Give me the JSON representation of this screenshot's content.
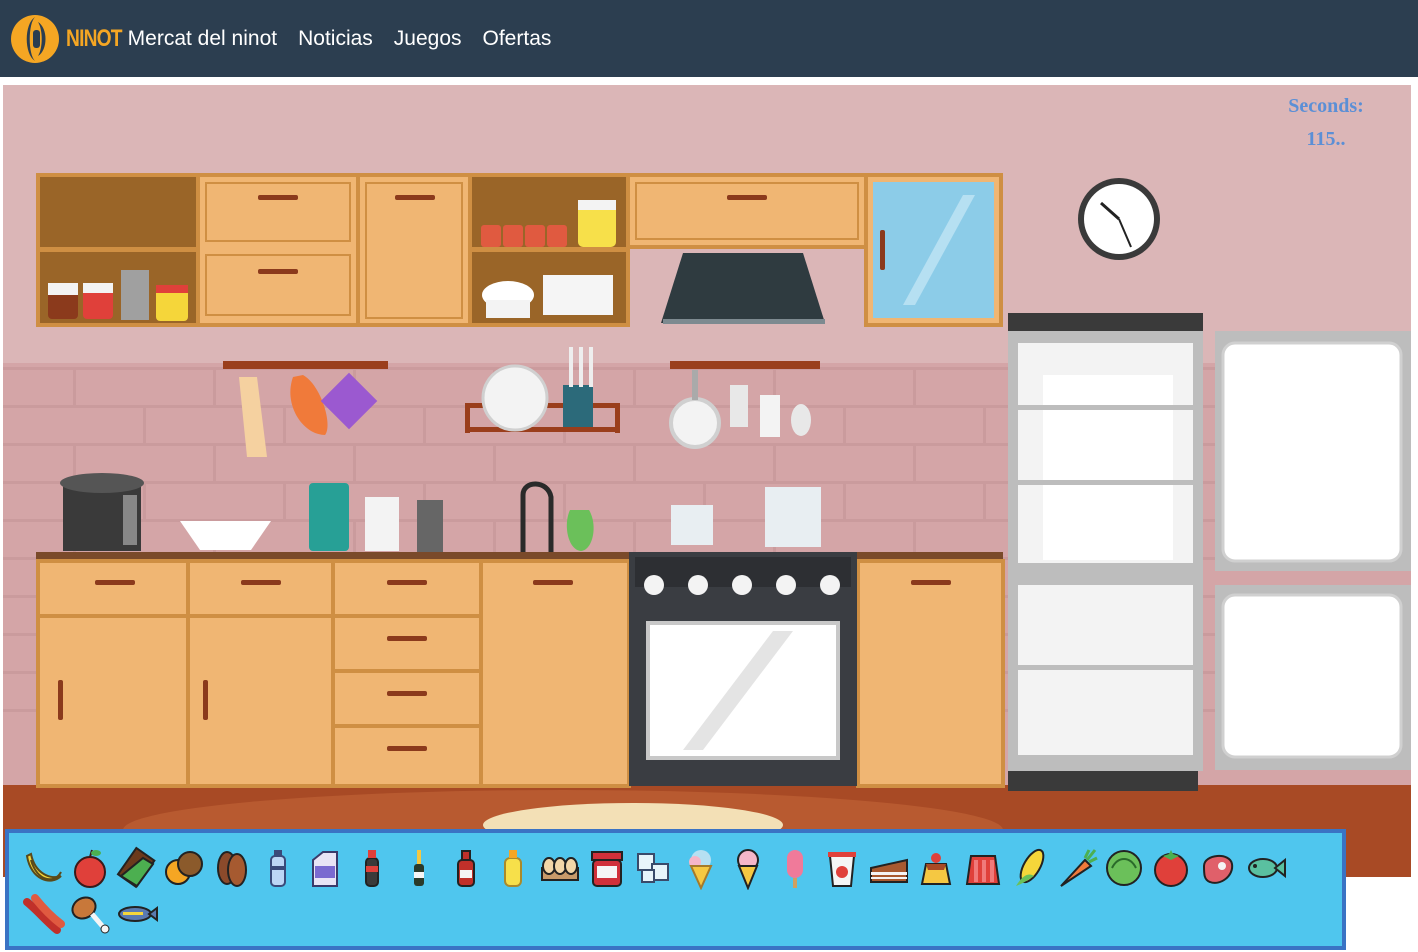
{
  "nav": {
    "logo_text": "NINOT",
    "links": [
      "Mercat del ninot",
      "Noticias",
      "Juegos",
      "Ofertas"
    ]
  },
  "timer": {
    "label": "Seconds:",
    "value": "115.."
  },
  "colors": {
    "navbar": "#2c3e50",
    "logo": "#f5a623",
    "wall": "#dbb6b7",
    "bricks": "#c8999b",
    "floor": "#a84a25",
    "cabinet": "#f0b673",
    "cabinet_border": "#cf8f43",
    "tray": "#4fc6ee",
    "tray_border": "#3a73c4",
    "timer": "#5b8fd6"
  },
  "food_items": [
    {
      "name": "banana-icon"
    },
    {
      "name": "apple-icon"
    },
    {
      "name": "chocolate-icon"
    },
    {
      "name": "hazelnut-icon"
    },
    {
      "name": "almond-icon"
    },
    {
      "name": "water-bottle-icon"
    },
    {
      "name": "milk-carton-icon"
    },
    {
      "name": "soda-bottle-icon"
    },
    {
      "name": "champagne-bottle-icon"
    },
    {
      "name": "ketchup-bottle-icon"
    },
    {
      "name": "juice-bottle-icon"
    },
    {
      "name": "eggs-icon"
    },
    {
      "name": "jam-jar-icon"
    },
    {
      "name": "ice-cubes-icon"
    },
    {
      "name": "ice-cream-cone-icon"
    },
    {
      "name": "ice-cream-icon"
    },
    {
      "name": "popsicle-icon"
    },
    {
      "name": "yogurt-icon"
    },
    {
      "name": "cake-slice-icon"
    },
    {
      "name": "flan-icon"
    },
    {
      "name": "jelly-icon"
    },
    {
      "name": "corn-icon"
    },
    {
      "name": "carrot-icon"
    },
    {
      "name": "lettuce-icon"
    },
    {
      "name": "tomato-icon"
    },
    {
      "name": "steak-icon"
    },
    {
      "name": "fish-icon"
    },
    {
      "name": "sausage-icon"
    },
    {
      "name": "chicken-leg-icon"
    },
    {
      "name": "tuna-icon"
    }
  ]
}
